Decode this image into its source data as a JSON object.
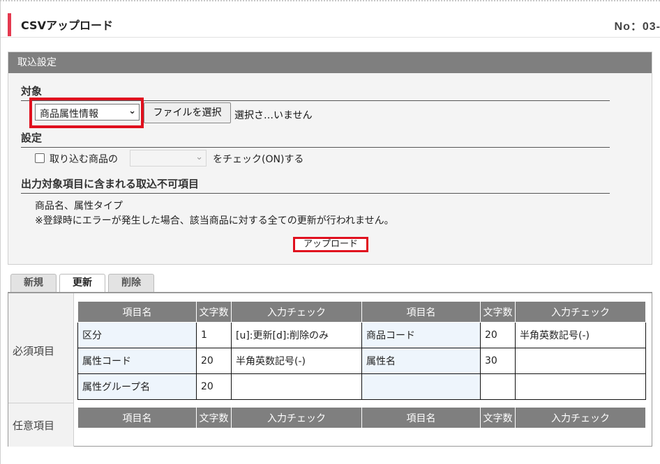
{
  "header": {
    "title": "CSVアップロード",
    "number": "No：03-"
  },
  "import_settings": {
    "panel_title": "取込設定",
    "target_section": "対象",
    "target_select_value": "商品属性情報",
    "file_button": "ファイルを選択",
    "file_status": "選択さ…いません",
    "settings_section": "設定",
    "checkbox_label": "取り込む商品の",
    "checkbox_suffix": "をチェック(ON)する",
    "output_section": "出力対象項目に含まれる取込不可項目",
    "output_items": "商品名、属性タイプ",
    "output_note": "※登録時にエラーが発生した場合、該当商品に対する全ての更新が行われません。",
    "upload_button": "アップロード"
  },
  "tabs": {
    "new": "新規",
    "update": "更新",
    "delete": "削除",
    "active": "更新"
  },
  "columns": {
    "name": "項目名",
    "chars": "文字数",
    "check": "入力チェック"
  },
  "required": {
    "label": "必須項目",
    "rows": [
      {
        "name1": "区分",
        "chars1": "1",
        "check1": "[u]:更新[d]:削除のみ",
        "name2": "商品コード",
        "chars2": "20",
        "check2": "半角英数記号(-)"
      },
      {
        "name1": "属性コード",
        "chars1": "20",
        "check1": "半角英数記号(-)",
        "name2": "属性名",
        "chars2": "30",
        "check2": ""
      },
      {
        "name1": "属性グループ名",
        "chars1": "20",
        "check1": "",
        "name2": "",
        "chars2": "",
        "check2": ""
      }
    ]
  },
  "optional": {
    "label": "任意項目"
  },
  "colors": {
    "accent_red": "#e4394f",
    "highlight_red": "#e0101e",
    "header_gray": "#7f7f7f",
    "name_cell_bg": "#eef5fc"
  }
}
